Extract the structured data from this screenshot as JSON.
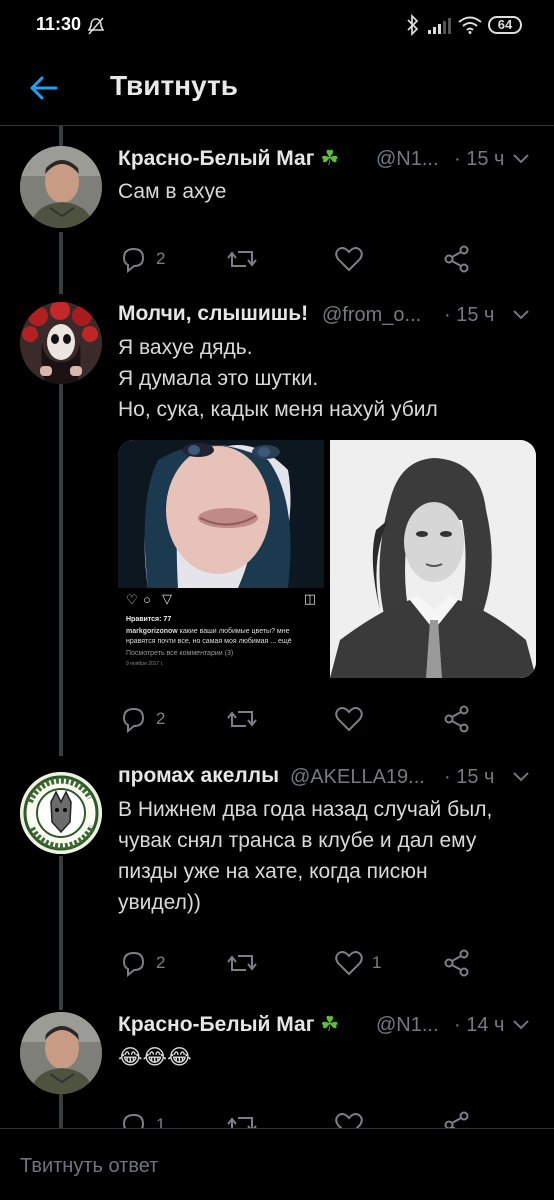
{
  "status_bar": {
    "time": "11:30",
    "battery": "64",
    "icons": [
      "mute-icon",
      "bluetooth-icon",
      "signal-icon",
      "wifi-icon",
      "battery-icon"
    ]
  },
  "header": {
    "title": "Твитнуть",
    "back_icon": "arrow-left-icon",
    "accent_color": "#1da1f2"
  },
  "tweets": [
    {
      "name": "Красно-Белый Маг",
      "name_emoji": "☘️",
      "handle": "@N1...",
      "time": "· 15 ч",
      "lines": [
        "Сам в ахуе"
      ],
      "replies": "2",
      "retweets": "",
      "likes": ""
    },
    {
      "name": "Молчи, слышишь!",
      "handle": "@from_o...",
      "time": "· 15 ч",
      "lines": [
        "Я вахуе дядь.",
        "Я думала это шутки.",
        "Но, сука, кадык меня нахуй убил"
      ],
      "media": {
        "insta_likes": "Нравится: 77",
        "insta_caption_user": "markgorizonow",
        "insta_caption_1": " какие ваши любимые цветы? мне",
        "insta_caption_2": "нравятся почти все, но самая моя любимая ... ещё",
        "insta_comments": "Посмотреть все комментарии (3)",
        "insta_date": "9 ноября 2017 г."
      },
      "replies": "2",
      "retweets": "",
      "likes": ""
    },
    {
      "name": "промах акеллы",
      "handle": "@AKELLA19...",
      "time": "· 15 ч",
      "lines": [
        "В Нижнем два года назад случай был,",
        "чувак снял транса в клубе и дал ему",
        "пизды уже на хате, когда писюн",
        "увидел))"
      ],
      "avatar_ring_text": "ЭТО БУДЕТ СЛАВНАЯ ОХОТА!",
      "replies": "2",
      "retweets": "",
      "likes": "1"
    },
    {
      "name": "Красно-Белый Маг",
      "name_emoji": "☘️",
      "handle": "@N1...",
      "time": "· 14 ч",
      "lines": [
        "😂😂😂"
      ],
      "replies": "1",
      "retweets": "",
      "likes": ""
    }
  ],
  "reply_bar": {
    "placeholder": "Твитнуть ответ"
  }
}
